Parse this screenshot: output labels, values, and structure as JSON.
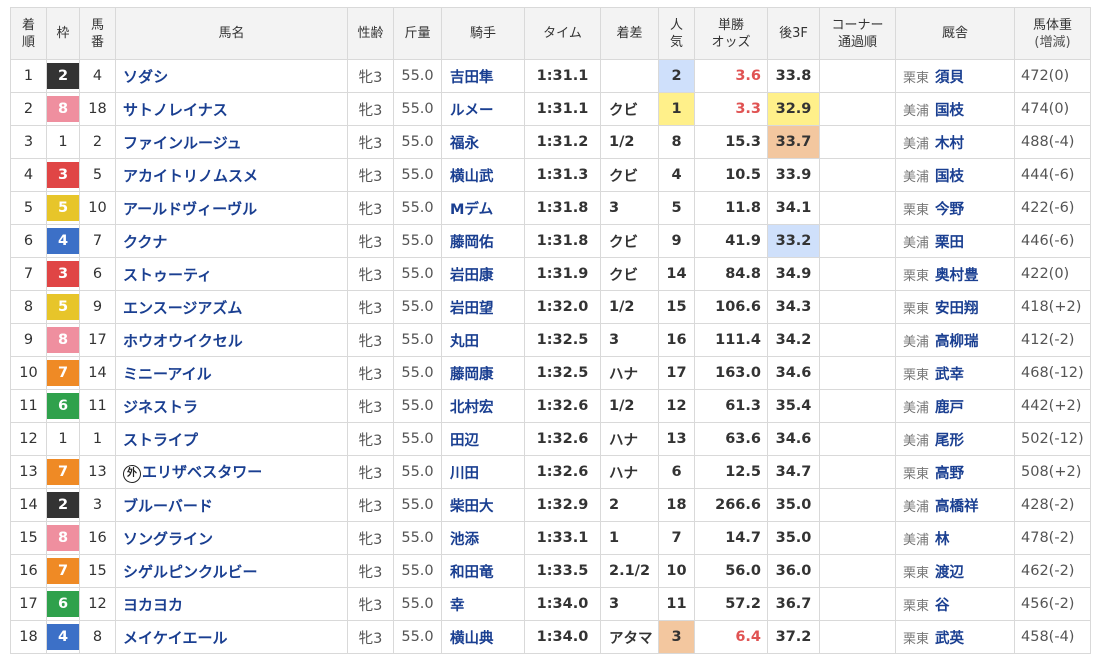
{
  "colors": {
    "waku": {
      "1": "#ffffff",
      "2": "#333333",
      "3": "#e04545",
      "4": "#3c70c7",
      "5": "#e7c52a",
      "6": "#2fa14c",
      "7": "#ef8a25",
      "8": "#ef8f9f"
    },
    "pop_rank": {
      "1": "#fff08a",
      "2": "#cfe0fb",
      "3": "#f3c79f"
    },
    "last3f_rank": {
      "1": "#fff08a",
      "2": "#cfe0fb",
      "3": "#f3c79f"
    },
    "header_bg": "#f3f3f3",
    "link": "#1a3f91",
    "fav_odds": "#e05353"
  },
  "headers": {
    "rank": [
      "着",
      "順"
    ],
    "waku": [
      "枠"
    ],
    "num": [
      "馬",
      "番"
    ],
    "name": [
      "馬名"
    ],
    "sex": [
      "性齢"
    ],
    "weight": [
      "斤量"
    ],
    "jockey": [
      "騎手"
    ],
    "time": [
      "タイム"
    ],
    "margin": [
      "着差"
    ],
    "pop": [
      "人",
      "気"
    ],
    "odds": [
      "単勝",
      "オッズ"
    ],
    "last3f": [
      "後3F"
    ],
    "corner": [
      "コーナー",
      "通過順"
    ],
    "stable": [
      "厩舎"
    ],
    "bodyweight": [
      "馬体重",
      "(増減)"
    ]
  },
  "rows": [
    {
      "rank": "1",
      "waku": "2",
      "num": "4",
      "mark": "",
      "name": "ソダシ",
      "sex": "牝3",
      "weight": "55.0",
      "jockey": "吉田隼",
      "time": "1:31.1",
      "margin": "",
      "pop": "2",
      "pop_rank": 2,
      "odds": "3.6",
      "odds_fav": true,
      "last3f": "33.8",
      "last3f_rank": 0,
      "corner": "",
      "region": "栗東",
      "trainer": "須貝",
      "bodyweight": "472(0)"
    },
    {
      "rank": "2",
      "waku": "8",
      "num": "18",
      "mark": "",
      "name": "サトノレイナス",
      "sex": "牝3",
      "weight": "55.0",
      "jockey": "ルメー",
      "time": "1:31.1",
      "margin": "クビ",
      "pop": "1",
      "pop_rank": 1,
      "odds": "3.3",
      "odds_fav": true,
      "last3f": "32.9",
      "last3f_rank": 1,
      "corner": "",
      "region": "美浦",
      "trainer": "国枝",
      "bodyweight": "474(0)"
    },
    {
      "rank": "3",
      "waku": "1",
      "num": "2",
      "mark": "",
      "name": "ファインルージュ",
      "sex": "牝3",
      "weight": "55.0",
      "jockey": "福永",
      "time": "1:31.2",
      "margin": "1/2",
      "pop": "8",
      "pop_rank": 0,
      "odds": "15.3",
      "odds_fav": false,
      "last3f": "33.7",
      "last3f_rank": 3,
      "corner": "",
      "region": "美浦",
      "trainer": "木村",
      "bodyweight": "488(-4)"
    },
    {
      "rank": "4",
      "waku": "3",
      "num": "5",
      "mark": "",
      "name": "アカイトリノムスメ",
      "sex": "牝3",
      "weight": "55.0",
      "jockey": "横山武",
      "time": "1:31.3",
      "margin": "クビ",
      "pop": "4",
      "pop_rank": 0,
      "odds": "10.5",
      "odds_fav": false,
      "last3f": "33.9",
      "last3f_rank": 0,
      "corner": "",
      "region": "美浦",
      "trainer": "国枝",
      "bodyweight": "444(-6)"
    },
    {
      "rank": "5",
      "waku": "5",
      "num": "10",
      "mark": "",
      "name": "アールドヴィーヴル",
      "sex": "牝3",
      "weight": "55.0",
      "jockey": "Mデム",
      "time": "1:31.8",
      "margin": "3",
      "pop": "5",
      "pop_rank": 0,
      "odds": "11.8",
      "odds_fav": false,
      "last3f": "34.1",
      "last3f_rank": 0,
      "corner": "",
      "region": "栗東",
      "trainer": "今野",
      "bodyweight": "422(-6)"
    },
    {
      "rank": "6",
      "waku": "4",
      "num": "7",
      "mark": "",
      "name": "ククナ",
      "sex": "牝3",
      "weight": "55.0",
      "jockey": "藤岡佑",
      "time": "1:31.8",
      "margin": "クビ",
      "pop": "9",
      "pop_rank": 0,
      "odds": "41.9",
      "odds_fav": false,
      "last3f": "33.2",
      "last3f_rank": 2,
      "corner": "",
      "region": "美浦",
      "trainer": "栗田",
      "bodyweight": "446(-6)"
    },
    {
      "rank": "7",
      "waku": "3",
      "num": "6",
      "mark": "",
      "name": "ストゥーティ",
      "sex": "牝3",
      "weight": "55.0",
      "jockey": "岩田康",
      "time": "1:31.9",
      "margin": "クビ",
      "pop": "14",
      "pop_rank": 0,
      "odds": "84.8",
      "odds_fav": false,
      "last3f": "34.9",
      "last3f_rank": 0,
      "corner": "",
      "region": "栗東",
      "trainer": "奥村豊",
      "bodyweight": "422(0)"
    },
    {
      "rank": "8",
      "waku": "5",
      "num": "9",
      "mark": "",
      "name": "エンスージアズム",
      "sex": "牝3",
      "weight": "55.0",
      "jockey": "岩田望",
      "time": "1:32.0",
      "margin": "1/2",
      "pop": "15",
      "pop_rank": 0,
      "odds": "106.6",
      "odds_fav": false,
      "last3f": "34.3",
      "last3f_rank": 0,
      "corner": "",
      "region": "栗東",
      "trainer": "安田翔",
      "bodyweight": "418(+2)"
    },
    {
      "rank": "9",
      "waku": "8",
      "num": "17",
      "mark": "",
      "name": "ホウオウイクセル",
      "sex": "牝3",
      "weight": "55.0",
      "jockey": "丸田",
      "time": "1:32.5",
      "margin": "3",
      "pop": "16",
      "pop_rank": 0,
      "odds": "111.4",
      "odds_fav": false,
      "last3f": "34.2",
      "last3f_rank": 0,
      "corner": "",
      "region": "美浦",
      "trainer": "高柳瑞",
      "bodyweight": "412(-2)"
    },
    {
      "rank": "10",
      "waku": "7",
      "num": "14",
      "mark": "",
      "name": "ミニーアイル",
      "sex": "牝3",
      "weight": "55.0",
      "jockey": "藤岡康",
      "time": "1:32.5",
      "margin": "ハナ",
      "pop": "17",
      "pop_rank": 0,
      "odds": "163.0",
      "odds_fav": false,
      "last3f": "34.6",
      "last3f_rank": 0,
      "corner": "",
      "region": "栗東",
      "trainer": "武幸",
      "bodyweight": "468(-12)"
    },
    {
      "rank": "11",
      "waku": "6",
      "num": "11",
      "mark": "",
      "name": "ジネストラ",
      "sex": "牝3",
      "weight": "55.0",
      "jockey": "北村宏",
      "time": "1:32.6",
      "margin": "1/2",
      "pop": "12",
      "pop_rank": 0,
      "odds": "61.3",
      "odds_fav": false,
      "last3f": "35.4",
      "last3f_rank": 0,
      "corner": "",
      "region": "美浦",
      "trainer": "鹿戸",
      "bodyweight": "442(+2)"
    },
    {
      "rank": "12",
      "waku": "1",
      "num": "1",
      "mark": "",
      "name": "ストライプ",
      "sex": "牝3",
      "weight": "55.0",
      "jockey": "田辺",
      "time": "1:32.6",
      "margin": "ハナ",
      "pop": "13",
      "pop_rank": 0,
      "odds": "63.6",
      "odds_fav": false,
      "last3f": "34.6",
      "last3f_rank": 0,
      "corner": "",
      "region": "美浦",
      "trainer": "尾形",
      "bodyweight": "502(-12)"
    },
    {
      "rank": "13",
      "waku": "7",
      "num": "13",
      "mark": "外",
      "name": "エリザベスタワー",
      "sex": "牝3",
      "weight": "55.0",
      "jockey": "川田",
      "time": "1:32.6",
      "margin": "ハナ",
      "pop": "6",
      "pop_rank": 0,
      "odds": "12.5",
      "odds_fav": false,
      "last3f": "34.7",
      "last3f_rank": 0,
      "corner": "",
      "region": "栗東",
      "trainer": "高野",
      "bodyweight": "508(+2)"
    },
    {
      "rank": "14",
      "waku": "2",
      "num": "3",
      "mark": "",
      "name": "ブルーバード",
      "sex": "牝3",
      "weight": "55.0",
      "jockey": "柴田大",
      "time": "1:32.9",
      "margin": "2",
      "pop": "18",
      "pop_rank": 0,
      "odds": "266.6",
      "odds_fav": false,
      "last3f": "35.0",
      "last3f_rank": 0,
      "corner": "",
      "region": "美浦",
      "trainer": "高橋祥",
      "bodyweight": "428(-2)"
    },
    {
      "rank": "15",
      "waku": "8",
      "num": "16",
      "mark": "",
      "name": "ソングライン",
      "sex": "牝3",
      "weight": "55.0",
      "jockey": "池添",
      "time": "1:33.1",
      "margin": "1",
      "pop": "7",
      "pop_rank": 0,
      "odds": "14.7",
      "odds_fav": false,
      "last3f": "35.0",
      "last3f_rank": 0,
      "corner": "",
      "region": "美浦",
      "trainer": "林",
      "bodyweight": "478(-2)"
    },
    {
      "rank": "16",
      "waku": "7",
      "num": "15",
      "mark": "",
      "name": "シゲルピンクルビー",
      "sex": "牝3",
      "weight": "55.0",
      "jockey": "和田竜",
      "time": "1:33.5",
      "margin": "2.1/2",
      "pop": "10",
      "pop_rank": 0,
      "odds": "56.0",
      "odds_fav": false,
      "last3f": "36.0",
      "last3f_rank": 0,
      "corner": "",
      "region": "栗東",
      "trainer": "渡辺",
      "bodyweight": "462(-2)"
    },
    {
      "rank": "17",
      "waku": "6",
      "num": "12",
      "mark": "",
      "name": "ヨカヨカ",
      "sex": "牝3",
      "weight": "55.0",
      "jockey": "幸",
      "time": "1:34.0",
      "margin": "3",
      "pop": "11",
      "pop_rank": 0,
      "odds": "57.2",
      "odds_fav": false,
      "last3f": "36.7",
      "last3f_rank": 0,
      "corner": "",
      "region": "栗東",
      "trainer": "谷",
      "bodyweight": "456(-2)"
    },
    {
      "rank": "18",
      "waku": "4",
      "num": "8",
      "mark": "",
      "name": "メイケイエール",
      "sex": "牝3",
      "weight": "55.0",
      "jockey": "横山典",
      "time": "1:34.0",
      "margin": "アタマ",
      "pop": "3",
      "pop_rank": 3,
      "odds": "6.4",
      "odds_fav": true,
      "last3f": "37.2",
      "last3f_rank": 0,
      "corner": "",
      "region": "栗東",
      "trainer": "武英",
      "bodyweight": "458(-4)"
    }
  ]
}
